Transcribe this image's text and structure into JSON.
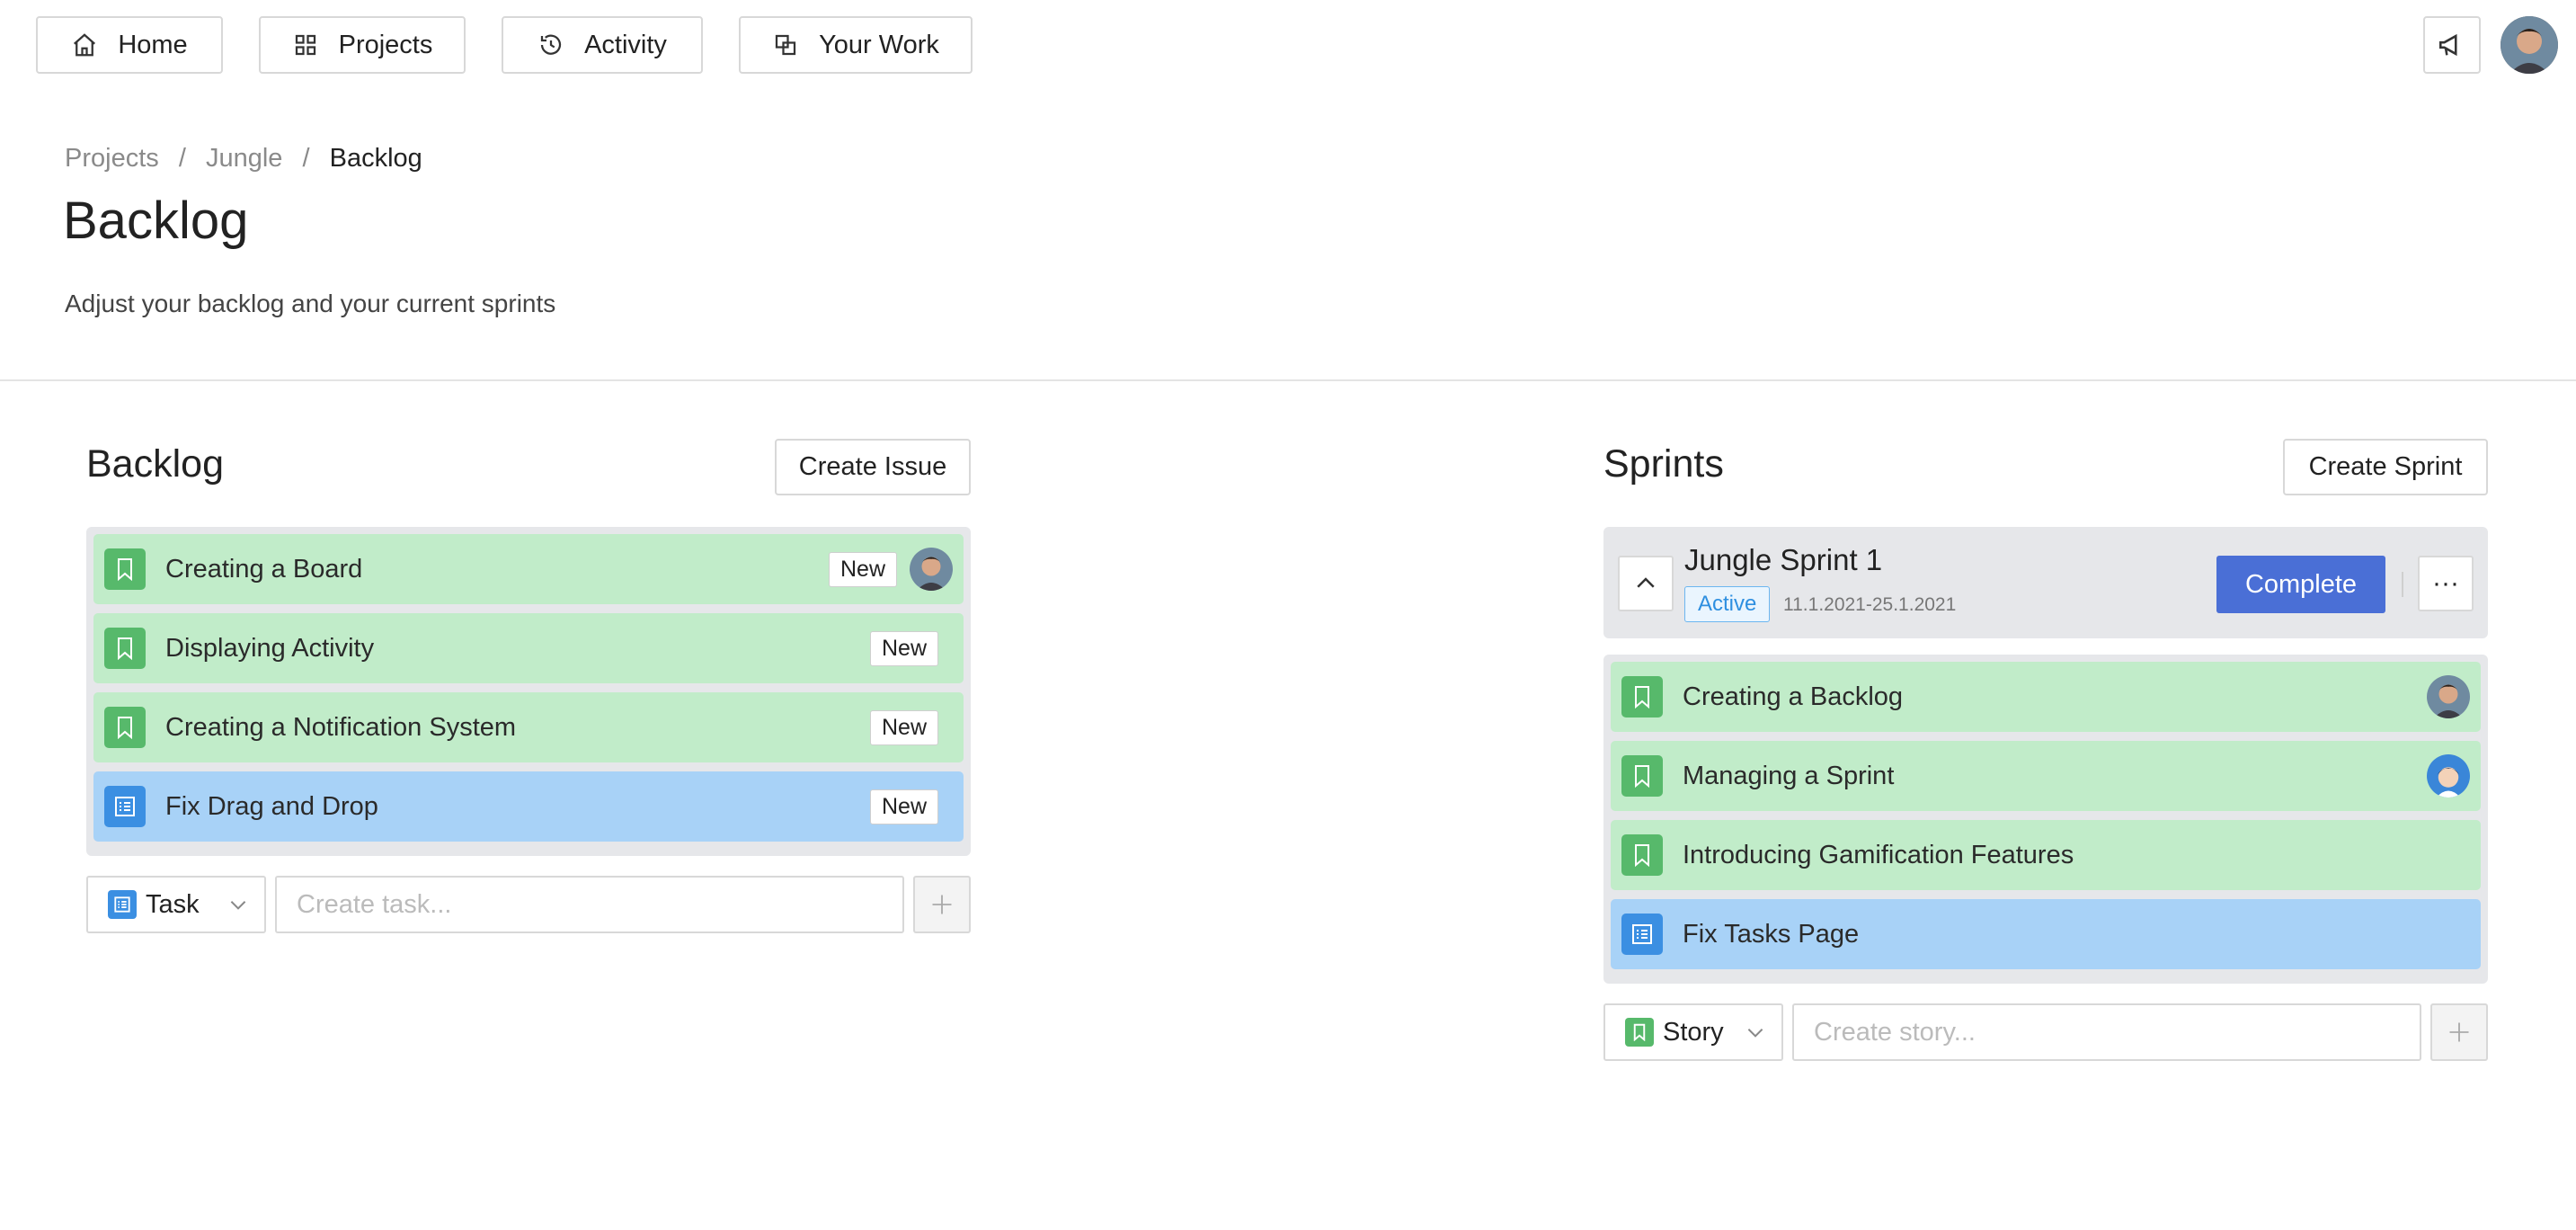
{
  "nav": {
    "home": "Home",
    "projects": "Projects",
    "activity": "Activity",
    "your_work": "Your Work"
  },
  "breadcrumb": [
    "Projects",
    "Jungle",
    "Backlog"
  ],
  "page": {
    "title": "Backlog",
    "subtitle": "Adjust your backlog and your current sprints"
  },
  "backlog": {
    "title": "Backlog",
    "create_button": "Create Issue",
    "issues": [
      {
        "title": "Creating a Board",
        "status": "New",
        "type": "story",
        "assignee": "avatar-user"
      },
      {
        "title": "Displaying Activity",
        "status": "New",
        "type": "story"
      },
      {
        "title": "Creating a Notification System",
        "status": "New",
        "type": "story"
      },
      {
        "title": "Fix Drag and Drop",
        "status": "New",
        "type": "task"
      }
    ],
    "type_select": "Task",
    "input_placeholder": "Create task..."
  },
  "sprints": {
    "title": "Sprints",
    "create_button": "Create Sprint",
    "sprint": {
      "name": "Jungle Sprint 1",
      "status": "Active",
      "dates": "11.1.2021-25.1.2021",
      "complete_button": "Complete",
      "more": "···"
    },
    "issues": [
      {
        "title": "Creating a Backlog",
        "type": "story",
        "assignee": "avatar-user"
      },
      {
        "title": "Managing a Sprint",
        "type": "story",
        "assignee": "avatar-cartoon"
      },
      {
        "title": "Introducing Gamification Features",
        "type": "story"
      },
      {
        "title": "Fix Tasks Page",
        "type": "task"
      }
    ],
    "type_select": "Story",
    "input_placeholder": "Create story..."
  },
  "colors": {
    "story_bg": "#c1ecc9",
    "task_bg": "#a8d2f7",
    "story_icon": "#57b96b",
    "task_icon": "#3b8fe2",
    "accent": "#4a6fd6"
  }
}
